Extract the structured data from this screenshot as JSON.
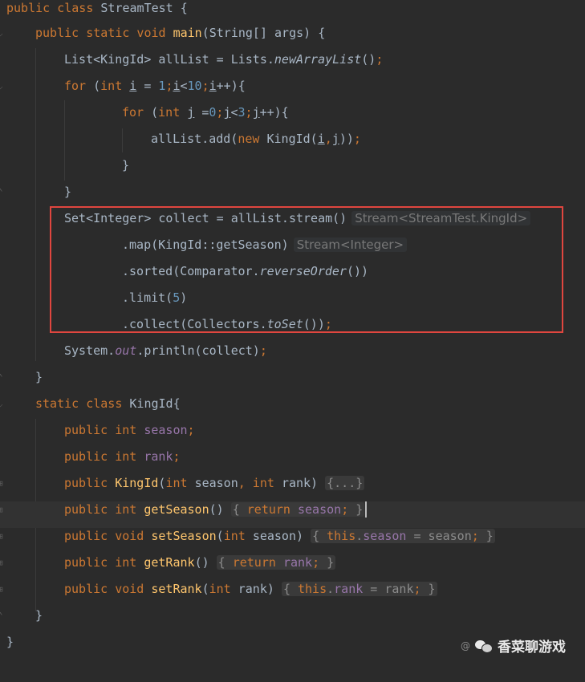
{
  "editor": {
    "lines": {
      "l1": "public class StreamTest {",
      "l2": "public static void main(String[] args) {",
      "l3a": "List<KingId> allList = Lists.",
      "l3b": "newArrayList",
      "l3c": "();",
      "l4": "for (int i = 1;i<10;i++){",
      "l5": "for (int j =0;j<3;j++){",
      "l6": "allList.add(new KingId(i,j));",
      "l7": "}",
      "l8": "}",
      "l9a": "Set<Integer> collect = allList.stream()",
      "l9hint": "Stream<StreamTest.KingId>",
      "l10a": ".map(KingId::getSeason)",
      "l10hint": "Stream<Integer>",
      "l11a": ".sorted(Comparator.",
      "l11b": "reverseOrder",
      "l11c": "())",
      "l12": ".limit(5)",
      "l13a": ".collect(Collectors.",
      "l13b": "toSet",
      "l13c": "());",
      "l14a": "System.",
      "l14b": "out",
      "l14c": ".println(collect);",
      "l15": "}",
      "l16": "static class KingId{",
      "l17": "public int season;",
      "l18": "public int rank;",
      "l19a": "public KingId(int season, int rank) ",
      "l19b": "{...}",
      "l20a": "public int getSeason() ",
      "l20b": "{ return season; }",
      "l21a": "public void setSeason(int season) ",
      "l21b": "{ this.season = season; }",
      "l22a": "public int getRank() ",
      "l22b": "{ return rank; }",
      "l23a": "public void setRank(int rank) ",
      "l23b": "{ this.rank = rank; }",
      "l24": "}",
      "l25": "}"
    }
  },
  "watermark": {
    "text": "香菜聊游戏",
    "prefix": "@"
  },
  "colors": {
    "background": "#2b2b2b",
    "keyword": "#cc7832",
    "number": "#6897bb",
    "field": "#9876aa",
    "method_decl": "#ffc66d",
    "text": "#a9b7c6",
    "hint": "#787878",
    "highlight_box": "#e0463f"
  }
}
